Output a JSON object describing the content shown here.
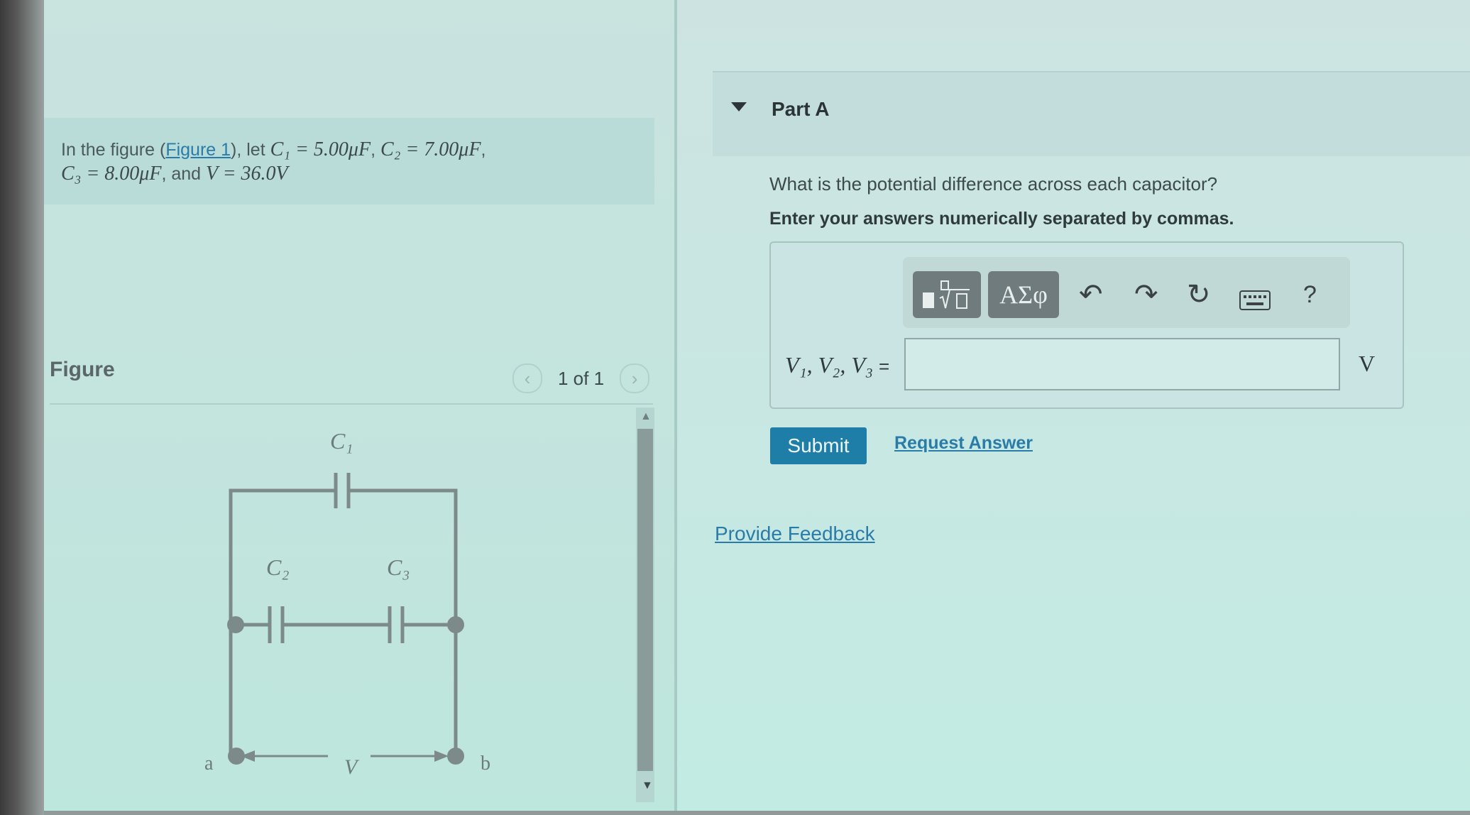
{
  "problem": {
    "intro": "In the figure (",
    "figure_link": "Figure 1",
    "after_link": "), let ",
    "c1_eq": "C₁ = 5.00μF",
    "c2_eq": "C₂ = 7.00μF",
    "c3_eq": "C₃ = 8.00μF",
    "and_text": ", and ",
    "v_eq": "V = 36.0V"
  },
  "figure": {
    "title": "Figure",
    "pager": "1 of 1",
    "prev_icon": "chevron-left-icon",
    "next_icon": "chevron-right-icon",
    "labels": {
      "c1": "C₁",
      "c2": "C₂",
      "c3": "C₃",
      "a": "a",
      "b": "b",
      "v": "V"
    }
  },
  "part_a": {
    "title": "Part A",
    "question": "What is the potential difference across each capacitor?",
    "instruction": "Enter your answers numerically separated by commas.",
    "variables": "V₁, V₂, V₃",
    "equals": "=",
    "input_value": "",
    "unit": "V",
    "toolbar": {
      "templates_icon": "math-templates-icon",
      "symbols_label": "ΑΣφ",
      "undo_icon": "undo-icon",
      "redo_icon": "redo-icon",
      "reset_icon": "reset-icon",
      "keyboard_icon": "keyboard-icon",
      "help_label": "?"
    },
    "submit_label": "Submit",
    "request_label": "Request Answer"
  },
  "feedback_label": "Provide Feedback",
  "colors": {
    "accent": "#1f7ea8",
    "link": "#2a7ca8",
    "toolbar_button": "#6f7b7d"
  }
}
